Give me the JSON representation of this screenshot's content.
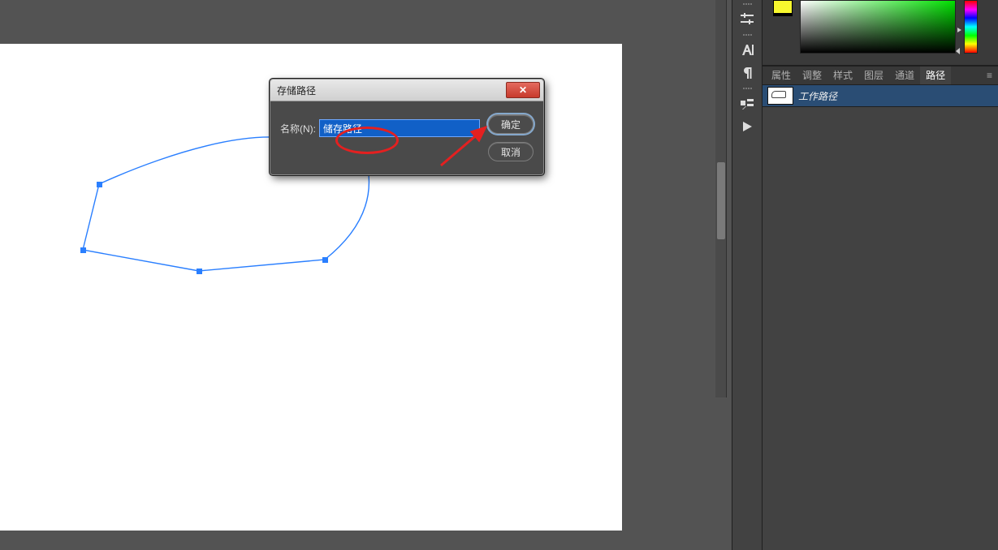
{
  "dialog": {
    "title": "存储路径",
    "name_label": "名称(N):",
    "name_value": "储存路径",
    "ok": "确定",
    "cancel": "取消"
  },
  "panel_tabs": {
    "items": [
      "属性",
      "调整",
      "样式",
      "图层",
      "通道",
      "路径"
    ],
    "active_index": 5
  },
  "paths_panel": {
    "items": [
      {
        "label": "工作路径"
      }
    ]
  },
  "icons": {
    "sliders": "sliders-icon",
    "character": "character-icon",
    "paragraph": "paragraph-icon",
    "ruler": "ruler-icon",
    "play": "play-icon",
    "close": "✕",
    "panel_menu": "≡"
  },
  "swatches": {
    "foreground": "#f8f82e"
  }
}
